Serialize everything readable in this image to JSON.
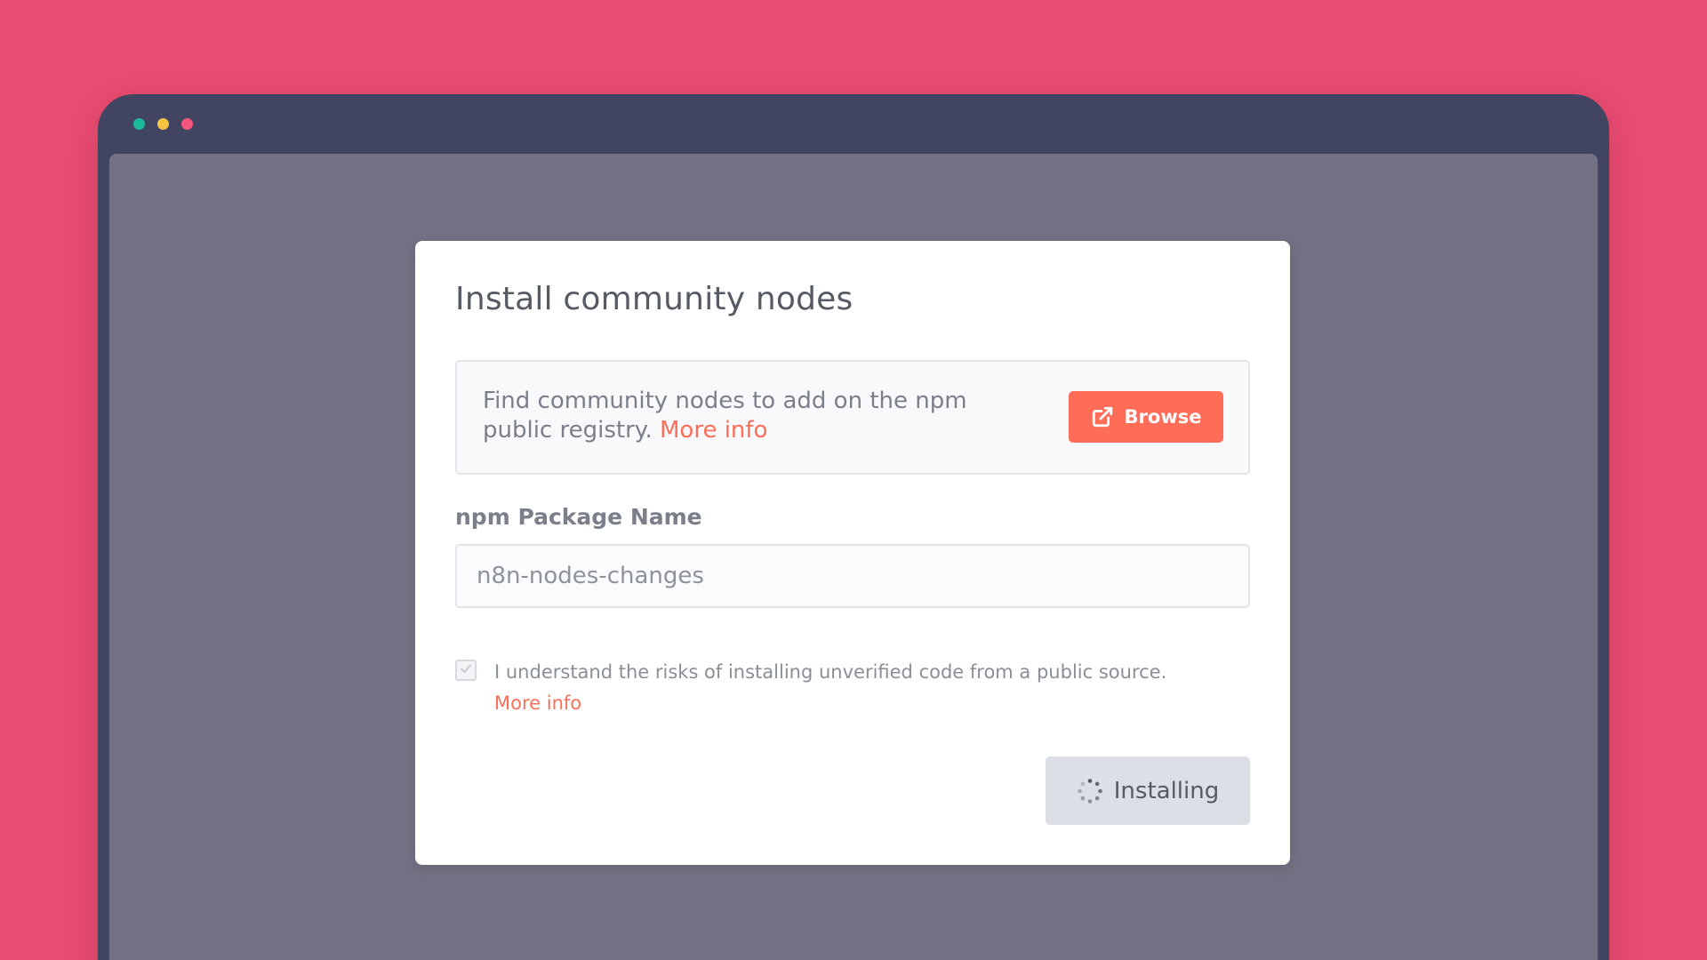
{
  "window": {
    "controls": [
      {
        "name": "close",
        "color": "#1eb89a"
      },
      {
        "name": "minimize",
        "color": "#f5c342"
      },
      {
        "name": "maximize",
        "color": "#f3567a"
      }
    ]
  },
  "modal": {
    "title": "Install community nodes",
    "info": {
      "text": "Find community nodes to add on the npm public registry.",
      "more_info_label": "More info",
      "browse_label": "Browse",
      "browse_icon": "external-link-icon"
    },
    "package_field": {
      "label": "npm Package Name",
      "value": "n8n-nodes-changes"
    },
    "risk_checkbox": {
      "checked": true,
      "label": "I understand the risks of installing unverified code from a public source.",
      "more_info_label": "More info"
    },
    "install_button": {
      "label": "Installing",
      "icon": "spinner-icon"
    }
  },
  "colors": {
    "background": "#eb4c71",
    "window_frame": "#414562",
    "overlay": "#737183",
    "accent": "#ff6d59",
    "link": "#fa6f5a",
    "disabled_button": "#dcdfe6"
  }
}
